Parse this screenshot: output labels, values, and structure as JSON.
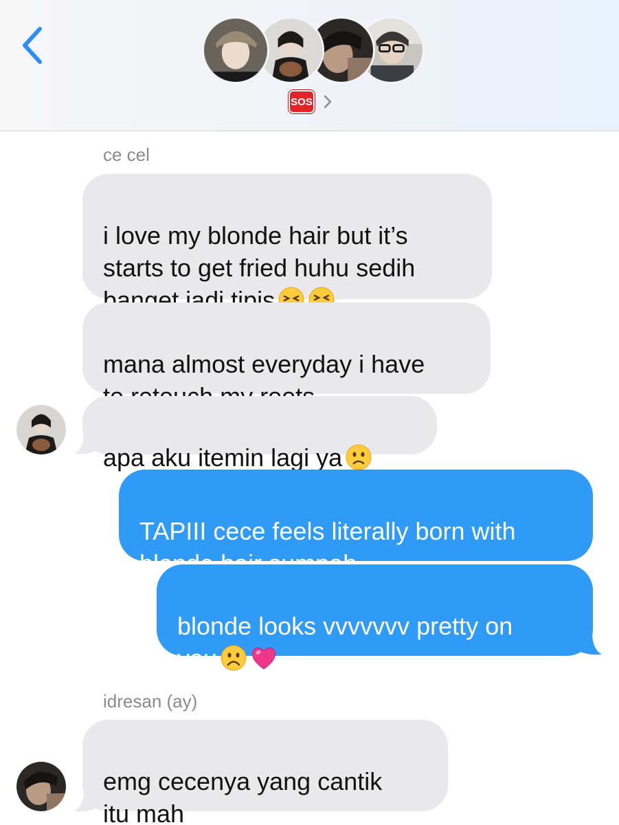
{
  "header": {
    "group_name": "SOS",
    "participants": [
      {
        "name": "participant-1",
        "avatar_color": "#4a4540"
      },
      {
        "name": "participant-2",
        "avatar_color": "#d9d6d2"
      },
      {
        "name": "participant-3",
        "avatar_color": "#2d2a28"
      },
      {
        "name": "participant-4",
        "avatar_color": "#a7a29c"
      }
    ],
    "back_icon": "chevron-left-icon",
    "info_icon": "chevron-right-icon"
  },
  "messages": [
    {
      "id": "m1",
      "sender": "ce cel",
      "direction": "incoming",
      "text": "i love my blonde hair but it’s\nstarts to get fried huhu sedih\nbanget jadi tipis",
      "emojis": [
        "persevering-face",
        "confounded-face"
      ]
    },
    {
      "id": "m2",
      "direction": "incoming",
      "text": "mana almost everyday i have\nto retouch my roots",
      "emojis": []
    },
    {
      "id": "m3",
      "direction": "incoming",
      "text": "apa aku itemin lagi ya",
      "emojis": [
        "slightly-frowning-face"
      ]
    },
    {
      "id": "m4",
      "direction": "outgoing",
      "text": "TAPIII cece feels literally born with\nblonde hair sumpah",
      "emojis": []
    },
    {
      "id": "m5",
      "direction": "outgoing",
      "text": "blonde looks vvvvvvv pretty on\nyou",
      "emojis": [
        "frowning-face",
        "pink-heart"
      ]
    },
    {
      "id": "m6",
      "sender": "idresan (ay)",
      "direction": "incoming",
      "text": "emg cecenya yang cantik\nitu mah",
      "emojis": []
    }
  ],
  "colors": {
    "incoming_bubble": "#e9e9eb",
    "outgoing_bubble": "#2f9bf6",
    "accent": "#2f8cf6",
    "sos_badge": "#e0242a"
  }
}
